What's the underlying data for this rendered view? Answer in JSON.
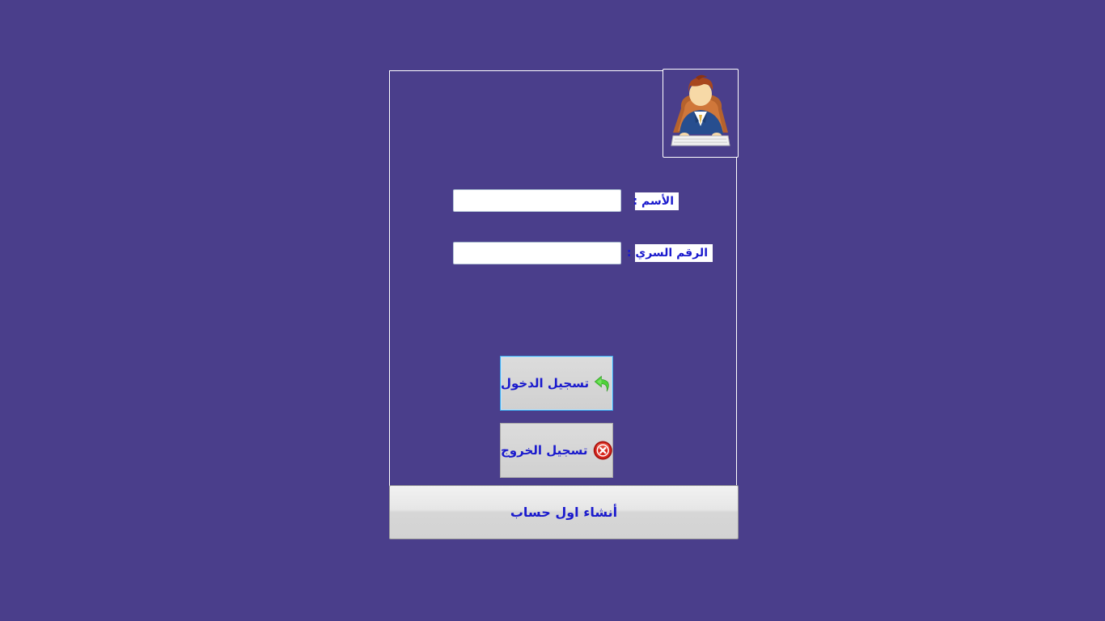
{
  "form": {
    "name_label": "الأسم :",
    "password_label": "الرقم السري :",
    "name_value": "",
    "password_value": ""
  },
  "buttons": {
    "login_label": "تسجيل الدخول",
    "logout_label": "تسجيل الخروج",
    "create_account_label": "أنشاء اول حساب"
  },
  "icons": {
    "avatar": "user-at-keyboard-icon",
    "login": "green-back-arrow-icon",
    "logout": "red-x-circle-icon"
  },
  "colors": {
    "background": "#4a3e8b",
    "label_text": "#1a1acd",
    "login_border": "#3ea6e8"
  }
}
